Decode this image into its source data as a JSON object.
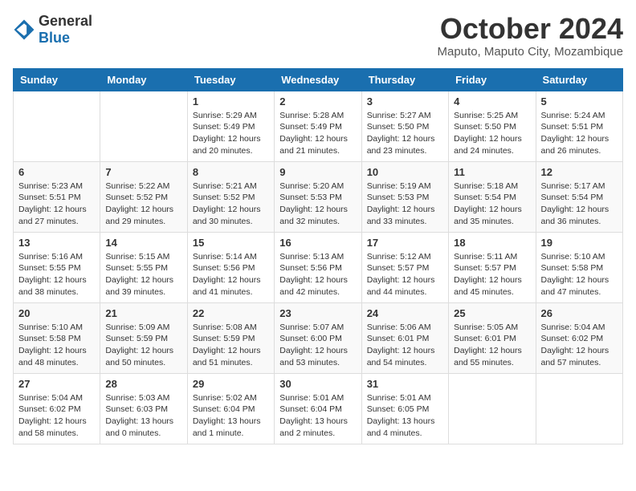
{
  "header": {
    "logo_general": "General",
    "logo_blue": "Blue",
    "month_title": "October 2024",
    "subtitle": "Maputo, Maputo City, Mozambique"
  },
  "weekdays": [
    "Sunday",
    "Monday",
    "Tuesday",
    "Wednesday",
    "Thursday",
    "Friday",
    "Saturday"
  ],
  "weeks": [
    [
      {
        "day": "",
        "info": ""
      },
      {
        "day": "",
        "info": ""
      },
      {
        "day": "1",
        "info": "Sunrise: 5:29 AM\nSunset: 5:49 PM\nDaylight: 12 hours and 20 minutes."
      },
      {
        "day": "2",
        "info": "Sunrise: 5:28 AM\nSunset: 5:49 PM\nDaylight: 12 hours and 21 minutes."
      },
      {
        "day": "3",
        "info": "Sunrise: 5:27 AM\nSunset: 5:50 PM\nDaylight: 12 hours and 23 minutes."
      },
      {
        "day": "4",
        "info": "Sunrise: 5:25 AM\nSunset: 5:50 PM\nDaylight: 12 hours and 24 minutes."
      },
      {
        "day": "5",
        "info": "Sunrise: 5:24 AM\nSunset: 5:51 PM\nDaylight: 12 hours and 26 minutes."
      }
    ],
    [
      {
        "day": "6",
        "info": "Sunrise: 5:23 AM\nSunset: 5:51 PM\nDaylight: 12 hours and 27 minutes."
      },
      {
        "day": "7",
        "info": "Sunrise: 5:22 AM\nSunset: 5:52 PM\nDaylight: 12 hours and 29 minutes."
      },
      {
        "day": "8",
        "info": "Sunrise: 5:21 AM\nSunset: 5:52 PM\nDaylight: 12 hours and 30 minutes."
      },
      {
        "day": "9",
        "info": "Sunrise: 5:20 AM\nSunset: 5:53 PM\nDaylight: 12 hours and 32 minutes."
      },
      {
        "day": "10",
        "info": "Sunrise: 5:19 AM\nSunset: 5:53 PM\nDaylight: 12 hours and 33 minutes."
      },
      {
        "day": "11",
        "info": "Sunrise: 5:18 AM\nSunset: 5:54 PM\nDaylight: 12 hours and 35 minutes."
      },
      {
        "day": "12",
        "info": "Sunrise: 5:17 AM\nSunset: 5:54 PM\nDaylight: 12 hours and 36 minutes."
      }
    ],
    [
      {
        "day": "13",
        "info": "Sunrise: 5:16 AM\nSunset: 5:55 PM\nDaylight: 12 hours and 38 minutes."
      },
      {
        "day": "14",
        "info": "Sunrise: 5:15 AM\nSunset: 5:55 PM\nDaylight: 12 hours and 39 minutes."
      },
      {
        "day": "15",
        "info": "Sunrise: 5:14 AM\nSunset: 5:56 PM\nDaylight: 12 hours and 41 minutes."
      },
      {
        "day": "16",
        "info": "Sunrise: 5:13 AM\nSunset: 5:56 PM\nDaylight: 12 hours and 42 minutes."
      },
      {
        "day": "17",
        "info": "Sunrise: 5:12 AM\nSunset: 5:57 PM\nDaylight: 12 hours and 44 minutes."
      },
      {
        "day": "18",
        "info": "Sunrise: 5:11 AM\nSunset: 5:57 PM\nDaylight: 12 hours and 45 minutes."
      },
      {
        "day": "19",
        "info": "Sunrise: 5:10 AM\nSunset: 5:58 PM\nDaylight: 12 hours and 47 minutes."
      }
    ],
    [
      {
        "day": "20",
        "info": "Sunrise: 5:10 AM\nSunset: 5:58 PM\nDaylight: 12 hours and 48 minutes."
      },
      {
        "day": "21",
        "info": "Sunrise: 5:09 AM\nSunset: 5:59 PM\nDaylight: 12 hours and 50 minutes."
      },
      {
        "day": "22",
        "info": "Sunrise: 5:08 AM\nSunset: 5:59 PM\nDaylight: 12 hours and 51 minutes."
      },
      {
        "day": "23",
        "info": "Sunrise: 5:07 AM\nSunset: 6:00 PM\nDaylight: 12 hours and 53 minutes."
      },
      {
        "day": "24",
        "info": "Sunrise: 5:06 AM\nSunset: 6:01 PM\nDaylight: 12 hours and 54 minutes."
      },
      {
        "day": "25",
        "info": "Sunrise: 5:05 AM\nSunset: 6:01 PM\nDaylight: 12 hours and 55 minutes."
      },
      {
        "day": "26",
        "info": "Sunrise: 5:04 AM\nSunset: 6:02 PM\nDaylight: 12 hours and 57 minutes."
      }
    ],
    [
      {
        "day": "27",
        "info": "Sunrise: 5:04 AM\nSunset: 6:02 PM\nDaylight: 12 hours and 58 minutes."
      },
      {
        "day": "28",
        "info": "Sunrise: 5:03 AM\nSunset: 6:03 PM\nDaylight: 13 hours and 0 minutes."
      },
      {
        "day": "29",
        "info": "Sunrise: 5:02 AM\nSunset: 6:04 PM\nDaylight: 13 hours and 1 minute."
      },
      {
        "day": "30",
        "info": "Sunrise: 5:01 AM\nSunset: 6:04 PM\nDaylight: 13 hours and 2 minutes."
      },
      {
        "day": "31",
        "info": "Sunrise: 5:01 AM\nSunset: 6:05 PM\nDaylight: 13 hours and 4 minutes."
      },
      {
        "day": "",
        "info": ""
      },
      {
        "day": "",
        "info": ""
      }
    ]
  ]
}
